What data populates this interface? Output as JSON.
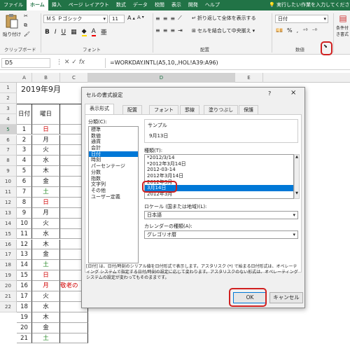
{
  "menubar": {
    "items": [
      "ファイル",
      "ホーム",
      "挿入",
      "ページ レイアウト",
      "数式",
      "データ",
      "校閲",
      "表示",
      "開発",
      "ヘルプ"
    ],
    "tellme": "実行したい作業を入力してください"
  },
  "ribbon": {
    "paste": "貼り付け",
    "clipboard": "クリップボード",
    "font_name": "ＭＳ Ｐゴシック",
    "font_size": "11",
    "font_group": "フォント",
    "wrap": "折り返して全体を表示する",
    "merge": "セルを結合して中央揃え",
    "align_group": "配置",
    "number_format": "日付",
    "number_group": "数値",
    "conditional": "条件付き書式"
  },
  "formula_bar": {
    "namebox": "D5",
    "fx": "fx",
    "formula": "=WORKDAY.INTL(A5,10,,HOL!A39:A96)"
  },
  "sheet": {
    "columns": [
      "A",
      "B",
      "C",
      "D",
      "E"
    ],
    "title": "2019年9月",
    "headers": [
      "日付",
      "曜日"
    ],
    "rows": [
      {
        "n": "1",
        "d": "1",
        "w": "日",
        "red": true
      },
      {
        "n": "2",
        "d": "2",
        "w": "月",
        "red": false
      },
      {
        "n": "3",
        "d": "3",
        "w": "火",
        "red": false
      },
      {
        "n": "4",
        "d": "4",
        "w": "水",
        "red": false
      },
      {
        "n": "5",
        "d": "5",
        "w": "木",
        "red": false
      },
      {
        "n": "6",
        "d": "6",
        "w": "金",
        "red": false
      },
      {
        "n": "7",
        "d": "7",
        "w": "土",
        "red": false
      },
      {
        "n": "8",
        "d": "8",
        "w": "日",
        "red": true
      },
      {
        "n": "9",
        "d": "9",
        "w": "月",
        "red": false
      },
      {
        "n": "10",
        "d": "10",
        "w": "火",
        "red": false
      },
      {
        "n": "11",
        "d": "11",
        "w": "水",
        "red": false
      },
      {
        "n": "12",
        "d": "12",
        "w": "木",
        "red": false
      },
      {
        "n": "13",
        "d": "13",
        "w": "金",
        "red": false
      },
      {
        "n": "14",
        "d": "14",
        "w": "土",
        "red": false
      },
      {
        "n": "15",
        "d": "15",
        "w": "日",
        "red": true
      },
      {
        "n": "16",
        "d": "16",
        "w": "月",
        "red": true
      },
      {
        "n": "17",
        "d": "17",
        "w": "火",
        "red": false
      },
      {
        "n": "18",
        "d": "18",
        "w": "水",
        "red": false
      },
      {
        "n": "19",
        "d": "19",
        "w": "木",
        "red": false
      },
      {
        "n": "20",
        "d": "20",
        "w": "金",
        "red": false
      },
      {
        "n": "21",
        "d": "21",
        "w": "土",
        "red": false
      }
    ],
    "note": "敬老の"
  },
  "dialog": {
    "title": "セルの書式設定",
    "help": "?",
    "close": "×",
    "tabs": [
      "表示形式",
      "配置",
      "フォント",
      "罫線",
      "塗りつぶし",
      "保護"
    ],
    "category_label": "分類(C):",
    "categories": [
      "標準",
      "数値",
      "通貨",
      "会計",
      "日付",
      "時刻",
      "パーセンテージ",
      "分数",
      "指数",
      "文字列",
      "その他",
      "ユーザー定義"
    ],
    "selected_category": 4,
    "sample_label": "サンプル",
    "sample_value": "9月13日",
    "type_label": "種類(T):",
    "types": [
      "*2012/3/14",
      "*2012年3月14日",
      "2012-03-14",
      "2012年3月14日",
      "2012年3月",
      "3月14日",
      "2012年3月"
    ],
    "selected_type": 5,
    "locale_label": "ロケール (国または地域)(L):",
    "locale_value": "日本語",
    "calendar_label": "カレンダーの種類(A):",
    "calendar_value": "グレゴリオ暦",
    "description": "[日付] は、日付/時刻のシリアル値を日付形式で表示します。アスタリスク (*) で始まる日付形式は、オペレーティング システムで指定する日付/時刻の設定に応じて変わります。アスタリスクのない形式は、オペレーティング システムの設定が変わってもそのままです。",
    "ok": "OK",
    "cancel": "キャンセル"
  },
  "colors": {
    "excel_green": "#217346",
    "highlight": "#0078d7",
    "annotation_red": "#d02020",
    "weekend_red": "#d00000",
    "saturday_green": "#2a8a2a"
  }
}
